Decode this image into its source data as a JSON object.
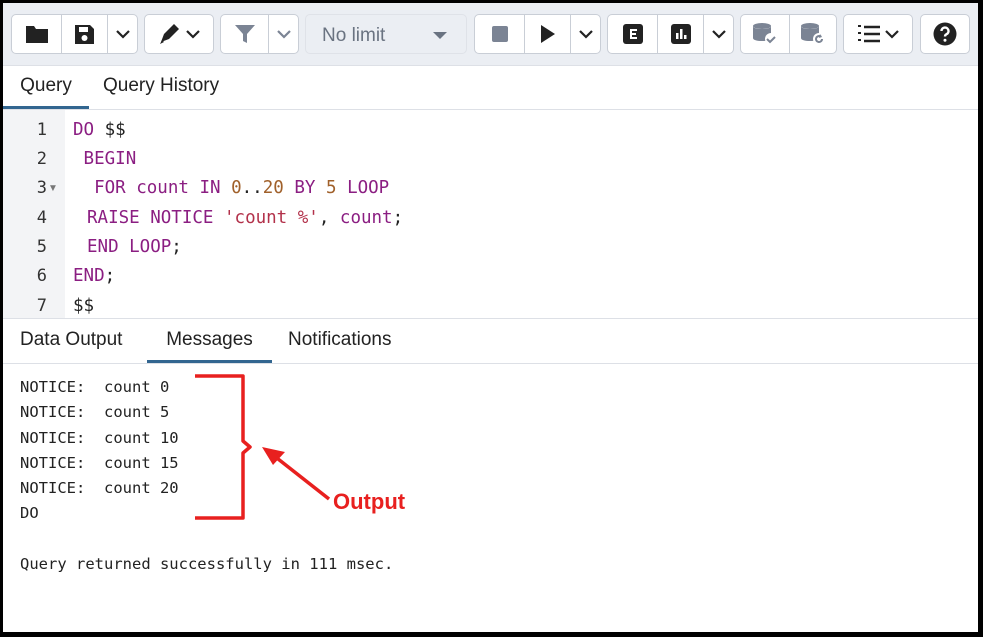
{
  "toolbar": {
    "limit_label": "No limit",
    "icons": [
      "folder-icon",
      "save-icon",
      "chevron-down-icon",
      "pen-icon",
      "chevron-down-icon",
      "filter-icon",
      "chevron-down-icon",
      "stop-icon",
      "play-icon",
      "chevron-down-icon",
      "explain-icon",
      "explain-analyze-icon",
      "chevron-down-icon",
      "commit-icon",
      "rollback-icon",
      "macros-icon",
      "help-icon"
    ]
  },
  "editor_tabs": [
    {
      "label": "Query",
      "active": true
    },
    {
      "label": "Query History",
      "active": false
    }
  ],
  "editor": {
    "line_numbers": [
      "1",
      "2",
      "3",
      "4",
      "5",
      "6",
      "7"
    ],
    "fold_marker": "▼"
  },
  "code": {
    "l1_kw": "DO",
    "l1_rest": " $$",
    "l2_indent": " ",
    "l2_kw": "BEGIN",
    "l3_indent": "  ",
    "l3_kw1": "FOR",
    "l3_sp1": " ",
    "l3_kw2": "count",
    "l3_sp2": " ",
    "l3_kw3": "IN",
    "l3_sp3": " ",
    "l3_num1": "0",
    "l3_dots": "..",
    "l3_num2": "20",
    "l3_sp4": " ",
    "l3_kw4": "BY",
    "l3_sp5": " ",
    "l3_num3": "5",
    "l3_sp6": " ",
    "l3_kw5": "LOOP",
    "l4_indent": "  ",
    "l4_kw1": "RAISE",
    "l4_sp1": " ",
    "l4_kw2": "NOTICE",
    "l4_sp2": " ",
    "l4_str": "'count %'",
    "l4_comma": ", ",
    "l4_kw3": "count",
    "l4_semi": ";",
    "l5_indent": "  ",
    "l5_kw": "END LOOP",
    "l5_semi": ";",
    "l6_kw": "END",
    "l6_semi": ";",
    "l7_text": "$$"
  },
  "result_tabs": [
    {
      "label": "Data Output",
      "active": false
    },
    {
      "label": "Messages",
      "active": true
    },
    {
      "label": "Notifications",
      "active": false
    }
  ],
  "messages": [
    "NOTICE:  count 0",
    "NOTICE:  count 5",
    "NOTICE:  count 10",
    "NOTICE:  count 15",
    "NOTICE:  count 20",
    "DO",
    "",
    "Query returned successfully in 111 msec."
  ],
  "annotation": {
    "label": "Output",
    "color": "#e8201f"
  },
  "colors": {
    "keyword": "#8b1e82",
    "number": "#a0602a",
    "string": "#b2314a",
    "active_tab": "#326690"
  }
}
